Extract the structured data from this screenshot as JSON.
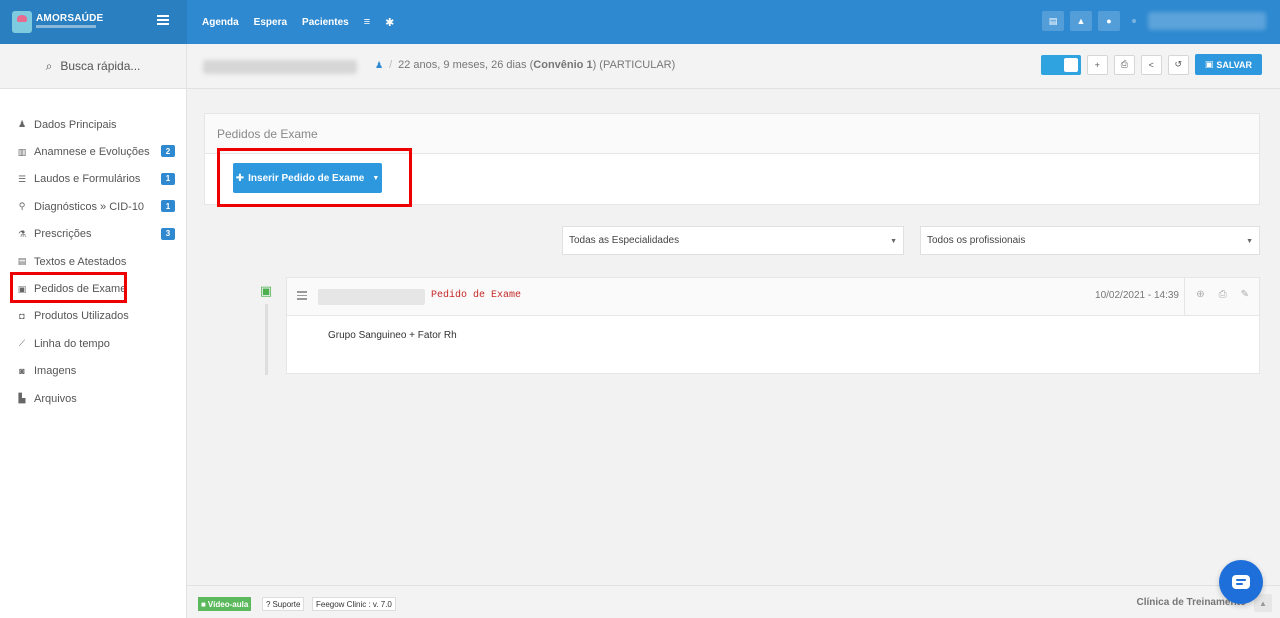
{
  "brand": {
    "name": "AMORSAÚDE"
  },
  "topnav": {
    "agenda": "Agenda",
    "espera": "Espera",
    "pacientes": "Pacientes",
    "database_icon": "≡",
    "gear_icon": "✱"
  },
  "topbar_right": {
    "list_icon": "▤",
    "bell_icon": "▲",
    "chat_icon": "●"
  },
  "sidebar": {
    "search": {
      "icon": "⌕",
      "label": "Busca rápida..."
    },
    "items": [
      {
        "label": "Dados Principais",
        "icon": "♟",
        "badge": ""
      },
      {
        "label": "Anamnese e Evoluções",
        "icon": "▥",
        "badge": "2"
      },
      {
        "label": "Laudos e Formulários",
        "icon": "☰",
        "badge": "1"
      },
      {
        "label": "Diagnósticos » CID-10",
        "icon": "⚲",
        "badge": "1"
      },
      {
        "label": "Prescrições",
        "icon": "⚗",
        "badge": "3"
      },
      {
        "label": "Textos e Atestados",
        "icon": "▤",
        "badge": ""
      },
      {
        "label": "Pedidos de Exame",
        "icon": "▣",
        "badge": ""
      },
      {
        "label": "Produtos Utilizados",
        "icon": "◘",
        "badge": ""
      },
      {
        "label": "Linha do tempo",
        "icon": "⟋",
        "badge": ""
      },
      {
        "label": "Imagens",
        "icon": "◙",
        "badge": ""
      },
      {
        "label": "Arquivos",
        "icon": "▙",
        "badge": ""
      }
    ]
  },
  "patient": {
    "age": "22 anos, 9 meses, 26 dias (",
    "convenio": "Convênio 1",
    "plan": ") (PARTICULAR)"
  },
  "toolbar": {
    "add": "+",
    "print": "⎙",
    "share": "<",
    "history": "↺",
    "save_label": "SALVAR",
    "save_icon": "▣"
  },
  "panel": {
    "title": "Pedidos de Exame",
    "insert_button": "Inserir Pedido de Exame",
    "insert_plus": "✚",
    "insert_caret": "▼"
  },
  "filters": {
    "specialty": "Todas as Especialidades",
    "professional": "Todos os profissionais",
    "arrow": "▼"
  },
  "entry": {
    "icon": "▣",
    "title": "Pedido de Exame",
    "date": "10/02/2021 - 14:39",
    "body": "Grupo Sanguineo + Fator Rh",
    "tools": {
      "zoom": "⊕",
      "print": "⎙",
      "attach": "✎"
    }
  },
  "footer": {
    "video_icon": "■",
    "video": "Vídeo-aula",
    "support_icon": "?",
    "support": "Suporte",
    "version": "Feegow Clinic : v. 7.0",
    "clinic": "Clínica de Treinamento",
    "to_top": "▲"
  },
  "colors": {
    "primary": "#2e89d0",
    "button": "#2e98de",
    "highlight": "#ee0000",
    "success": "#5cb85c",
    "entry_title": "#c62828"
  }
}
